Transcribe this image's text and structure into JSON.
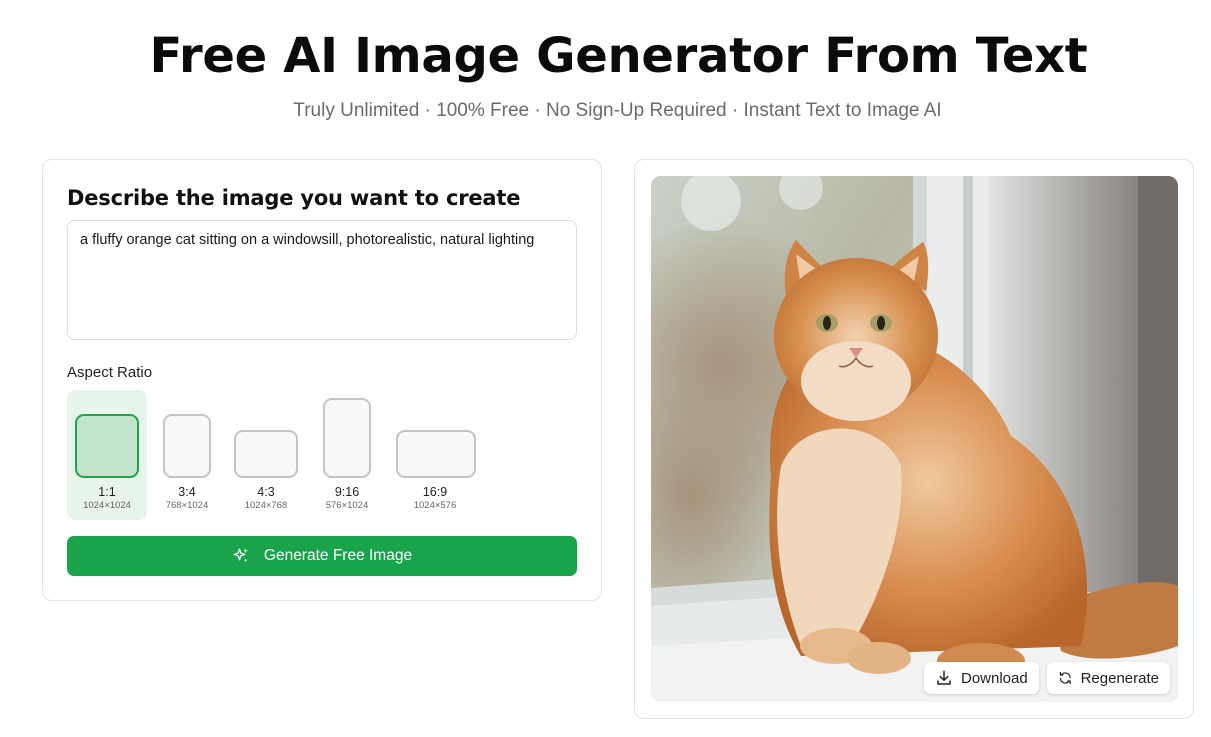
{
  "hero": {
    "title": "Free AI Image Generator From Text",
    "subtitle": "Truly Unlimited · 100% Free · No Sign-Up Required · Instant Text to Image AI"
  },
  "form": {
    "heading": "Describe the image you want to create",
    "prompt_value": "a fluffy orange cat sitting on a windowsill, photorealistic, natural lighting",
    "aspect_label": "Aspect Ratio",
    "ratios": [
      {
        "name": "1:1",
        "dims": "1024×1024",
        "selected": true
      },
      {
        "name": "3:4",
        "dims": "768×1024",
        "selected": false
      },
      {
        "name": "4:3",
        "dims": "1024×768",
        "selected": false
      },
      {
        "name": "9:16",
        "dims": "576×1024",
        "selected": false
      },
      {
        "name": "16:9",
        "dims": "1024×576",
        "selected": false
      }
    ],
    "generate_label": "Generate Free Image",
    "generate_icon": "sparkles-icon"
  },
  "result": {
    "image_subject": "orange-cat-on-windowsill-photo",
    "download_label": "Download",
    "download_icon": "download-icon",
    "regenerate_label": "Regenerate",
    "regenerate_icon": "refresh-icon"
  },
  "colors": {
    "accent": "#19a34b",
    "selected_bg": "#e6f4ea",
    "selected_shape": "#c2e5cc"
  }
}
